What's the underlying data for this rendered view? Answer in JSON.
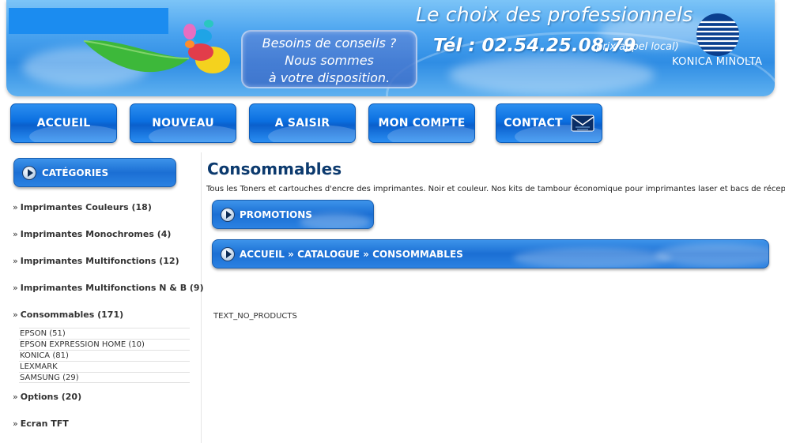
{
  "header": {
    "tagline": "Le choix des professionnels",
    "phone": "Tél  :  02.54.25.08.79",
    "phone_note": "(prix appel local)",
    "advice_lines": [
      "Besoins de conseils ?",
      "Nous sommes",
      "à votre disposition."
    ],
    "brand_text": "KONICA MINOLTA"
  },
  "nav": {
    "items": [
      {
        "label": "ACCUEIL"
      },
      {
        "label": "NOUVEAU"
      },
      {
        "label": "A SAISIR"
      },
      {
        "label": "MON COMPTE"
      },
      {
        "label": "CONTACT"
      }
    ]
  },
  "sidebar": {
    "header": "CATÉGORIES",
    "items": [
      {
        "label": "Imprimantes Couleurs (18)"
      },
      {
        "label": "Imprimantes Monochromes (4)"
      },
      {
        "label": "Imprimantes Multifonctions (12)"
      },
      {
        "label": "Imprimantes Multifonctions N & B (9)"
      },
      {
        "label": "Consommables (171)"
      },
      {
        "label": "Options (20)"
      },
      {
        "label": "Ecran TFT"
      }
    ],
    "raquo": "»",
    "subitems": [
      {
        "label": "EPSON (51)"
      },
      {
        "label": "EPSON EXPRESSION HOME (10)"
      },
      {
        "label": "KONICA (81)"
      },
      {
        "label": "LEXMARK"
      },
      {
        "label": "SAMSUNG (29)"
      }
    ]
  },
  "main": {
    "title": "Consommables",
    "description": "Tous les Toners et cartouches d'encre des imprimantes. Noir et couleur. Nos kits de tambour économique pour imprimantes laser et bacs de réception.",
    "promotions_label": "PROMOTIONS",
    "breadcrumb": [
      "ACCUEIL",
      "CATALOGUE",
      "CONSOMMABLES"
    ],
    "breadcrumb_sep": " » ",
    "no_products": "TEXT_NO_PRODUCTS"
  },
  "colors": {
    "header_blue": "#2f8de4",
    "nav_blue": "#0b6fe0",
    "title_navy": "#0c3a6e"
  }
}
